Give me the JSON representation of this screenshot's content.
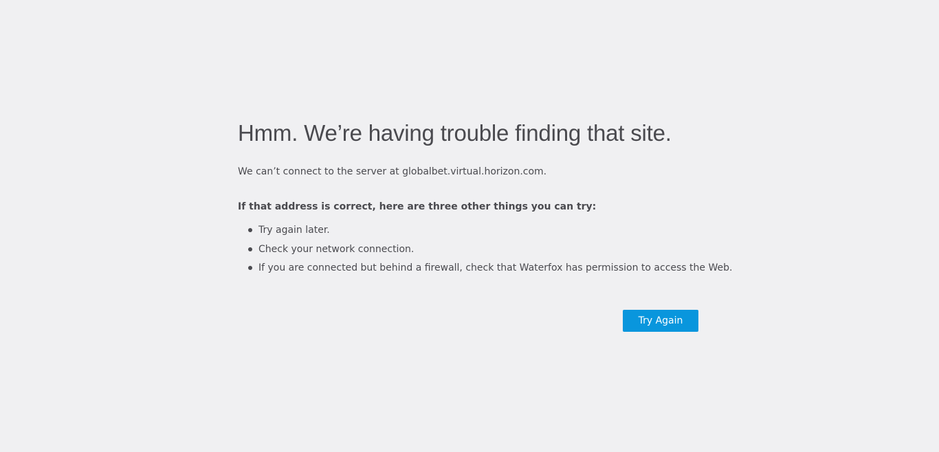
{
  "error": {
    "title": "Hmm. We’re having trouble finding that site.",
    "description": "We can’t connect to the server at globalbet.virtual.horizon.com.",
    "suggestions_heading": "If that address is correct, here are three other things you can try:",
    "suggestions": [
      "Try again later.",
      "Check your network connection.",
      "If you are connected but behind a firewall, check that Waterfox has permission to access the Web."
    ]
  },
  "actions": {
    "try_again_label": "Try Again"
  },
  "colors": {
    "background": "#f0f0f2",
    "text": "#4a4a4f",
    "button": "#0996dd",
    "button_text": "#ffffff"
  }
}
